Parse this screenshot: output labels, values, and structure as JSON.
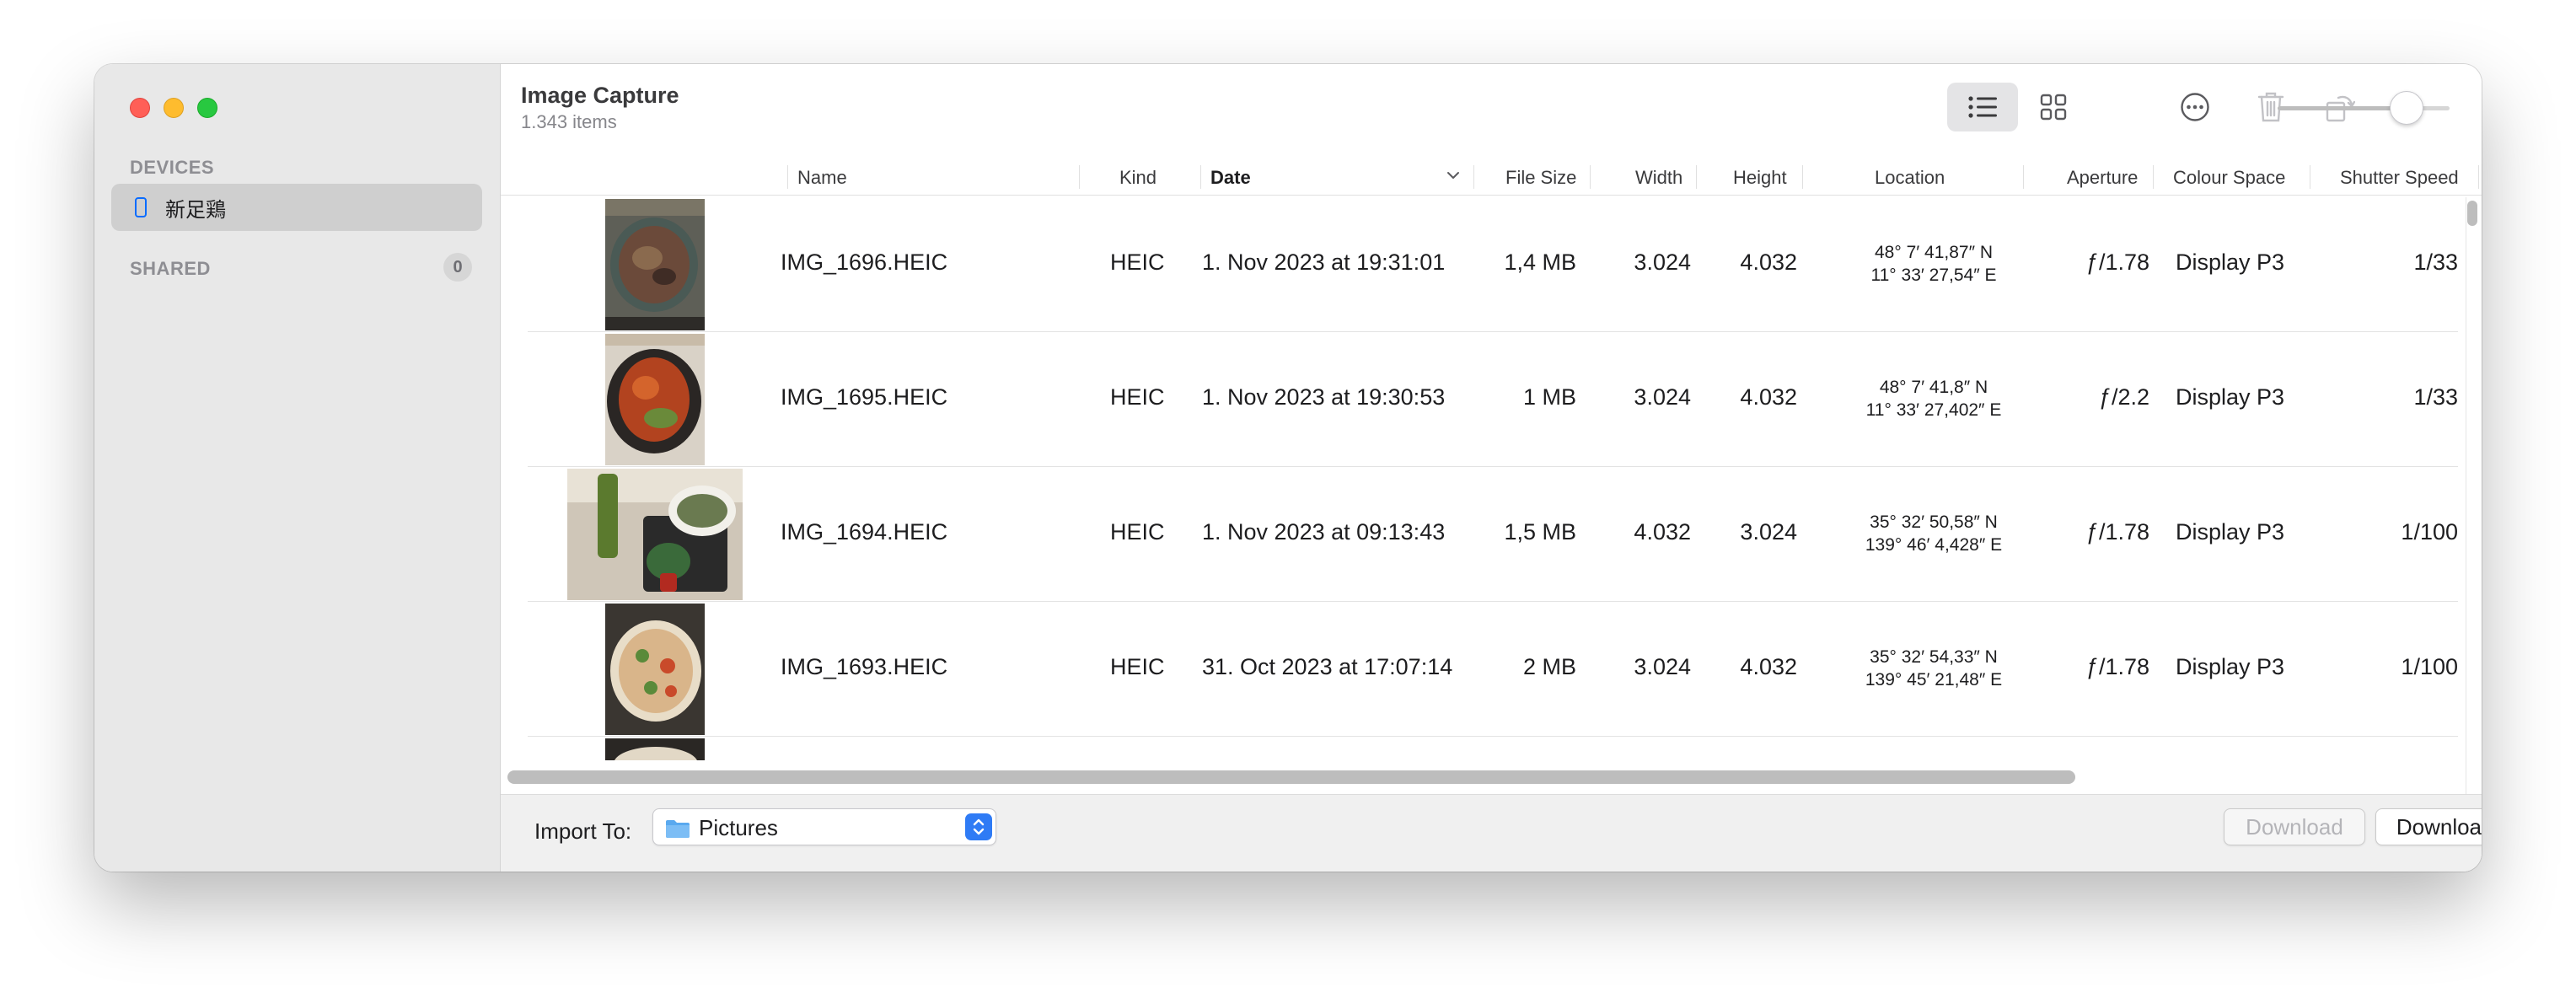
{
  "window": {
    "traffic_lights": [
      "close",
      "minimize",
      "maximize"
    ]
  },
  "sidebar": {
    "devices_heading": "DEVICES",
    "device": {
      "label": "新足鶏",
      "icon": "iphone-icon",
      "selected": true
    },
    "shared_heading": "SHARED",
    "shared_count": "0"
  },
  "header": {
    "title": "Image Capture",
    "subtitle": "1.343 items"
  },
  "toolbar": {
    "view_mode": "list",
    "buttons": [
      "list-view-icon",
      "grid-view-icon",
      "more-icon",
      "trash-icon",
      "rotate-icon"
    ],
    "thumbnail_size": 0.75
  },
  "table": {
    "columns": {
      "name": "Name",
      "kind": "Kind",
      "date": "Date",
      "file_size": "File Size",
      "width": "Width",
      "height": "Height",
      "location": "Location",
      "aperture": "Aperture",
      "colour_space": "Colour Space",
      "shutter_speed": "Shutter Speed"
    },
    "sorted_by": "Date",
    "rows": [
      {
        "name": "IMG_1696.HEIC",
        "kind": "HEIC",
        "date": "1. Nov 2023 at 19:31:01",
        "file_size": "1,4 MB",
        "width": "3.024",
        "height": "4.032",
        "location_lat": "48° 7′ 41,87″ N",
        "location_lon": "11° 33′ 27,54″ E",
        "aperture": "ƒ/1.78",
        "colour_space": "Display P3",
        "shutter_speed": "1/33",
        "thumb": "portrait"
      },
      {
        "name": "IMG_1695.HEIC",
        "kind": "HEIC",
        "date": "1. Nov 2023 at 19:30:53",
        "file_size": "1 MB",
        "width": "3.024",
        "height": "4.032",
        "location_lat": "48° 7′ 41,8″ N",
        "location_lon": "11° 33′ 27,402″ E",
        "aperture": "ƒ/2.2",
        "colour_space": "Display P3",
        "shutter_speed": "1/33",
        "thumb": "portrait"
      },
      {
        "name": "IMG_1694.HEIC",
        "kind": "HEIC",
        "date": "1. Nov 2023 at 09:13:43",
        "file_size": "1,5 MB",
        "width": "4.032",
        "height": "3.024",
        "location_lat": "35° 32′ 50,58″ N",
        "location_lon": "139° 46′ 4,428″ E",
        "aperture": "ƒ/1.78",
        "colour_space": "Display P3",
        "shutter_speed": "1/100",
        "thumb": "landscape"
      },
      {
        "name": "IMG_1693.HEIC",
        "kind": "HEIC",
        "date": "31. Oct 2023 at 17:07:14",
        "file_size": "2 MB",
        "width": "3.024",
        "height": "4.032",
        "location_lat": "35° 32′ 54,33″ N",
        "location_lon": "139° 45′ 21,48″ E",
        "aperture": "ƒ/1.78",
        "colour_space": "Display P3",
        "shutter_speed": "1/100",
        "thumb": "portrait"
      }
    ]
  },
  "footer": {
    "import_label": "Import To:",
    "import_value": "Pictures",
    "download_label": "Download",
    "download_all_label": "Download All"
  },
  "colors": {
    "accent": "#2f7bf5",
    "close": "#ff5f57",
    "minimize": "#febc2e",
    "maximize": "#28c840"
  }
}
